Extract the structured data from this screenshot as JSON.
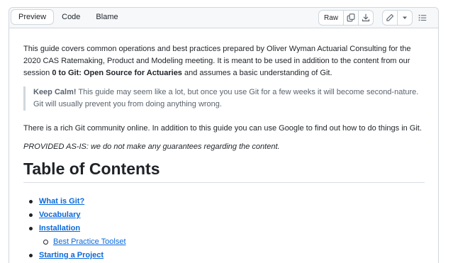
{
  "toolbar": {
    "tabs": [
      "Preview",
      "Code",
      "Blame"
    ],
    "raw_label": "Raw",
    "icons": [
      "copy-icon",
      "download-icon",
      "pencil-icon",
      "chevron-down-icon",
      "list-icon"
    ]
  },
  "content": {
    "intro_part1": "This guide covers common operations and best practices prepared by Oliver Wyman Actuarial Consulting for the 2020 CAS Ratemaking, Product and Modeling meeting. It is meant to be used in addition to the content from our session ",
    "intro_bold": "0 to Git: Open Source for Actuaries",
    "intro_part2": " and assumes a basic understanding of Git.",
    "quote_bold": "Keep Calm!",
    "quote_text": " This guide may seem like a lot, but once you use Git for a few weeks it will become second-nature. Git will usually prevent you from doing anything wrong.",
    "community": "There is a rich Git community online. In addition to this guide you can use Google to find out how to do things in Git.",
    "provided": "PROVIDED AS-IS: we do not make any guarantees regarding the content.",
    "toc_heading": "Table of Contents",
    "toc": [
      {
        "label": "What is Git?",
        "level": 1
      },
      {
        "label": "Vocabulary",
        "level": 1
      },
      {
        "label": "Installation",
        "level": 1
      },
      {
        "label": "Best Practice Toolset",
        "level": 2
      },
      {
        "label": "Starting a Project",
        "level": 1
      }
    ]
  }
}
